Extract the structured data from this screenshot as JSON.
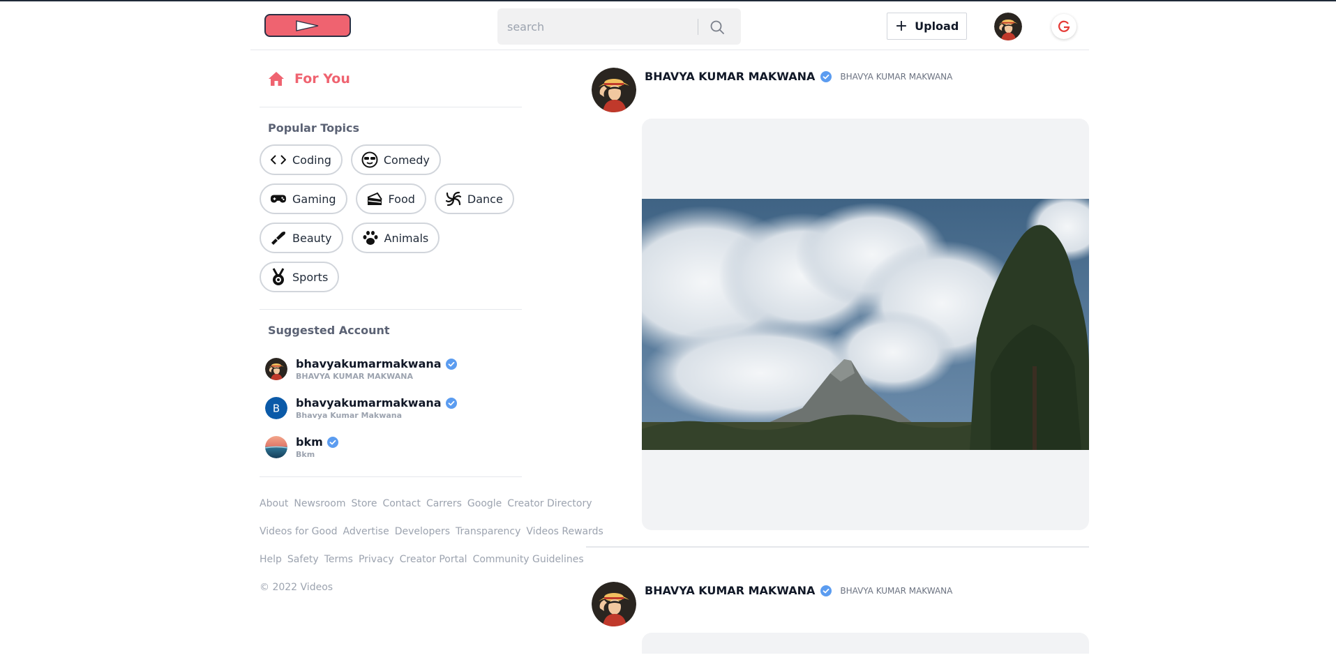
{
  "header": {
    "logo_name": "play-logo",
    "search": {
      "placeholder": "search",
      "value": ""
    },
    "upload_label": "Upload"
  },
  "sidebar": {
    "for_you_label": "For You",
    "popular_topics_title": "Popular Topics",
    "topics": [
      {
        "label": "Coding",
        "icon": "code-icon"
      },
      {
        "label": "Comedy",
        "icon": "sunglasses-face-icon"
      },
      {
        "label": "Gaming",
        "icon": "gamepad-icon"
      },
      {
        "label": "Food",
        "icon": "cake-icon"
      },
      {
        "label": "Dance",
        "icon": "spiral-icon"
      },
      {
        "label": "Beauty",
        "icon": "lipstick-icon"
      },
      {
        "label": "Animals",
        "icon": "paw-icon"
      },
      {
        "label": "Sports",
        "icon": "medal-icon"
      }
    ],
    "suggested_title": "Suggested Account",
    "accounts": [
      {
        "username": "bhavyakumarmakwana",
        "display": "BHAVYA KUMAR MAKWANA",
        "avatar": "portrait"
      },
      {
        "username": "bhavyakumarmakwana",
        "display": "Bhavya Kumar Makwana",
        "avatar": "letter",
        "letter": "B"
      },
      {
        "username": "bkm",
        "display": "Bkm",
        "avatar": "landscape"
      }
    ],
    "footer": {
      "group1": [
        "About",
        "Newsroom",
        "Store",
        "Contact",
        "Carrers",
        "Google",
        "Creator Directory"
      ],
      "group2": [
        "Videos for Good",
        "Advertise",
        "Developers",
        "Transparency",
        "Videos Rewards"
      ],
      "group3": [
        "Help",
        "Safety",
        "Terms",
        "Privacy",
        "Creator Portal",
        "Community Guidelines"
      ],
      "copyright": "© 2022 Videos"
    }
  },
  "feed": {
    "posts": [
      {
        "name": "BHAVYA KUMAR MAKWANA",
        "nickname": "BHAVYA KUMAR MAKWANA"
      },
      {
        "name": "BHAVYA KUMAR MAKWANA",
        "nickname": "BHAVYA KUMAR MAKWANA"
      }
    ]
  },
  "colors": {
    "accent": "#ef6370",
    "verified": "#3b82f6",
    "muted": "#9ca3af"
  }
}
